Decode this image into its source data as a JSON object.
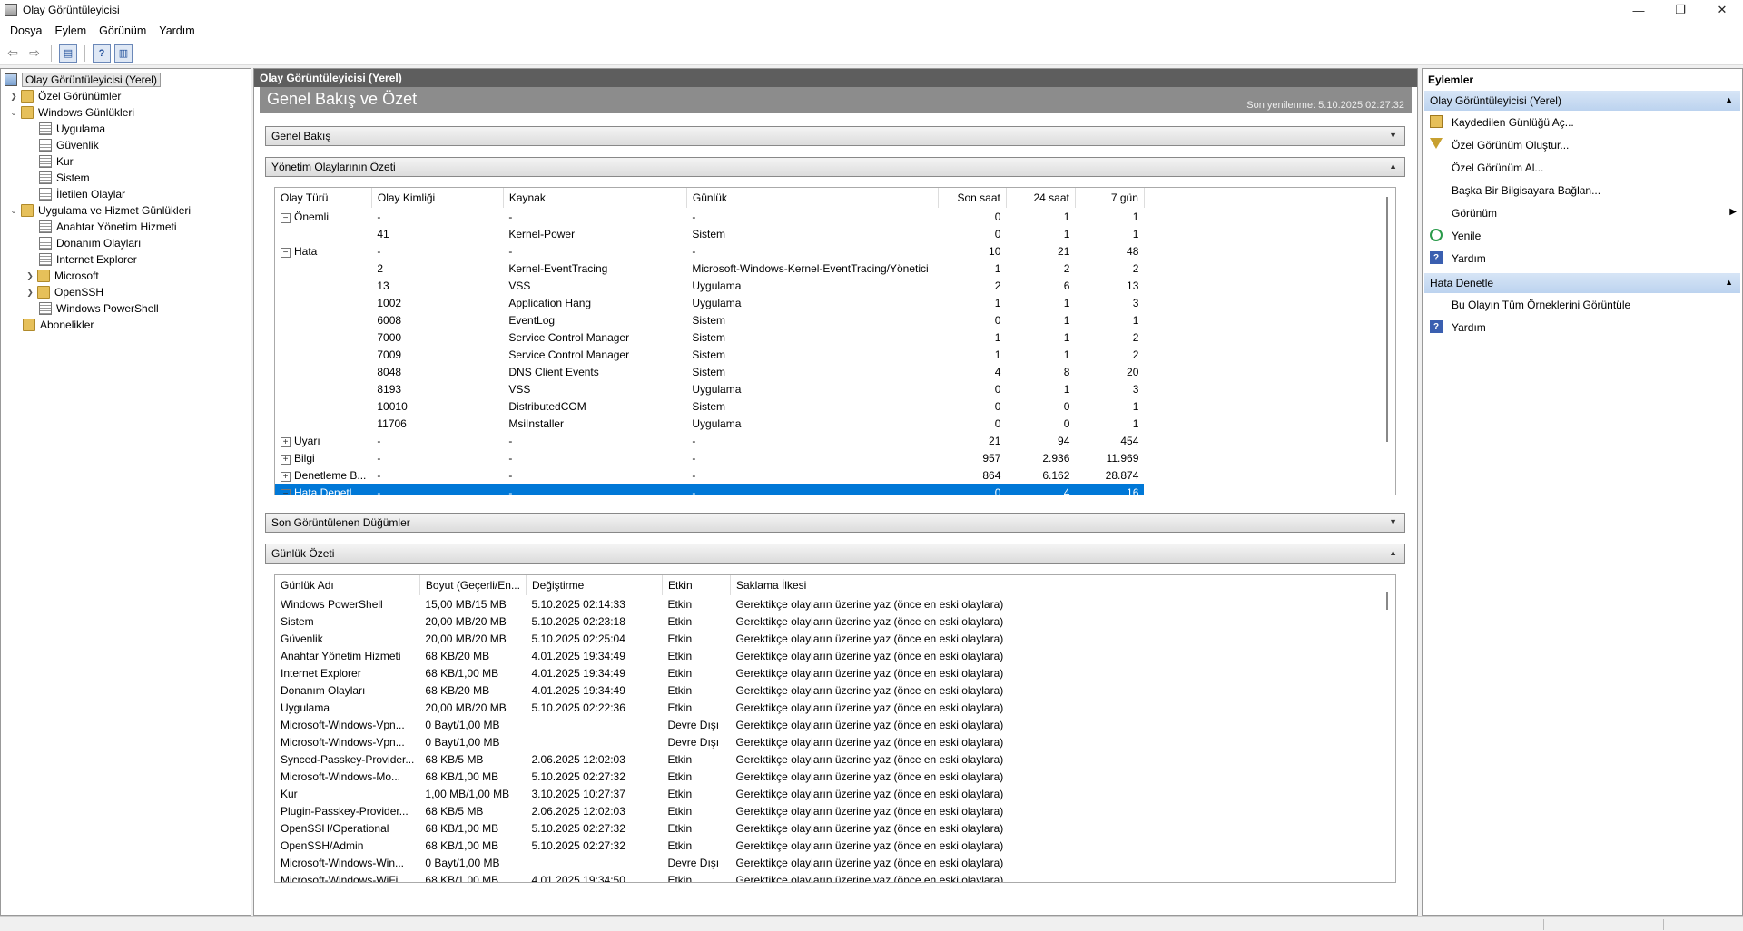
{
  "window": {
    "title": "Olay Görüntüleyicisi"
  },
  "menu": [
    "Dosya",
    "Eylem",
    "Görünüm",
    "Yardım"
  ],
  "tree": {
    "root": "Olay Görüntüleyicisi (Yerel)",
    "custom_views": "Özel Görünümler",
    "windows_logs": "Windows Günlükleri",
    "windows_log_items": [
      "Uygulama",
      "Güvenlik",
      "Kur",
      "Sistem",
      "İletilen Olaylar"
    ],
    "app_service_logs": "Uygulama ve Hizmet Günlükleri",
    "app_service_items": [
      "Anahtar Yönetim Hizmeti",
      "Donanım Olayları",
      "Internet Explorer",
      "Microsoft",
      "OpenSSH",
      "Windows PowerShell"
    ],
    "subscriptions": "Abonelikler"
  },
  "center": {
    "header": "Olay Görüntüleyicisi (Yerel)",
    "banner_title": "Genel Bakış ve Özet",
    "last_refreshed": "Son yenilenme: 5.10.2025 02:27:32",
    "sections": {
      "overview": "Genel Bakış",
      "admin_events": "Yönetim Olaylarının Özeti",
      "recent_nodes": "Son Görüntülenen Düğümler",
      "log_summary": "Günlük Özeti"
    },
    "admin_table": {
      "columns": [
        "Olay Türü",
        "Olay Kimliği",
        "Kaynak",
        "Günlük",
        "Son saat",
        "24 saat",
        "7 gün"
      ],
      "rows": [
        {
          "type": "Önemli",
          "expander": "−",
          "id": "-",
          "source": "-",
          "log": "-",
          "h1": "0",
          "h24": "1",
          "d7": "1"
        },
        {
          "type": "",
          "expander": "",
          "id": "41",
          "source": "Kernel-Power",
          "log": "Sistem",
          "h1": "0",
          "h24": "1",
          "d7": "1"
        },
        {
          "type": "Hata",
          "expander": "−",
          "id": "-",
          "source": "-",
          "log": "-",
          "h1": "10",
          "h24": "21",
          "d7": "48"
        },
        {
          "type": "",
          "expander": "",
          "id": "2",
          "source": "Kernel-EventTracing",
          "log": "Microsoft-Windows-Kernel-EventTracing/Yönetici",
          "h1": "1",
          "h24": "2",
          "d7": "2"
        },
        {
          "type": "",
          "expander": "",
          "id": "13",
          "source": "VSS",
          "log": "Uygulama",
          "h1": "2",
          "h24": "6",
          "d7": "13"
        },
        {
          "type": "",
          "expander": "",
          "id": "1002",
          "source": "Application Hang",
          "log": "Uygulama",
          "h1": "1",
          "h24": "1",
          "d7": "3"
        },
        {
          "type": "",
          "expander": "",
          "id": "6008",
          "source": "EventLog",
          "log": "Sistem",
          "h1": "0",
          "h24": "1",
          "d7": "1"
        },
        {
          "type": "",
          "expander": "",
          "id": "7000",
          "source": "Service Control Manager",
          "log": "Sistem",
          "h1": "1",
          "h24": "1",
          "d7": "2"
        },
        {
          "type": "",
          "expander": "",
          "id": "7009",
          "source": "Service Control Manager",
          "log": "Sistem",
          "h1": "1",
          "h24": "1",
          "d7": "2"
        },
        {
          "type": "",
          "expander": "",
          "id": "8048",
          "source": "DNS Client Events",
          "log": "Sistem",
          "h1": "4",
          "h24": "8",
          "d7": "20"
        },
        {
          "type": "",
          "expander": "",
          "id": "8193",
          "source": "VSS",
          "log": "Uygulama",
          "h1": "0",
          "h24": "1",
          "d7": "3"
        },
        {
          "type": "",
          "expander": "",
          "id": "10010",
          "source": "DistributedCOM",
          "log": "Sistem",
          "h1": "0",
          "h24": "0",
          "d7": "1"
        },
        {
          "type": "",
          "expander": "",
          "id": "11706",
          "source": "MsiInstaller",
          "log": "Uygulama",
          "h1": "0",
          "h24": "0",
          "d7": "1"
        },
        {
          "type": "Uyarı",
          "expander": "+",
          "id": "-",
          "source": "-",
          "log": "-",
          "h1": "21",
          "h24": "94",
          "d7": "454"
        },
        {
          "type": "Bilgi",
          "expander": "+",
          "id": "-",
          "source": "-",
          "log": "-",
          "h1": "957",
          "h24": "2.936",
          "d7": "11.969"
        },
        {
          "type": "Denetleme B...",
          "expander": "+",
          "id": "-",
          "source": "-",
          "log": "-",
          "h1": "864",
          "h24": "6.162",
          "d7": "28.874"
        },
        {
          "type": "Hata Denetl...",
          "expander": "−",
          "id": "-",
          "source": "-",
          "log": "-",
          "h1": "0",
          "h24": "4",
          "d7": "16",
          "selected": true
        }
      ]
    },
    "log_table": {
      "columns": [
        "Günlük Adı",
        "Boyut (Geçerli/En...",
        "Değiştirme",
        "Etkin",
        "Saklama İlkesi"
      ],
      "rows": [
        {
          "name": "Windows PowerShell",
          "size": "15,00 MB/15 MB",
          "modified": "5.10.2025 02:14:33",
          "enabled": "Etkin",
          "policy": "Gerektikçe olayların üzerine yaz (önce en eski olaylara)"
        },
        {
          "name": "Sistem",
          "size": "20,00 MB/20 MB",
          "modified": "5.10.2025 02:23:18",
          "enabled": "Etkin",
          "policy": "Gerektikçe olayların üzerine yaz (önce en eski olaylara)"
        },
        {
          "name": "Güvenlik",
          "size": "20,00 MB/20 MB",
          "modified": "5.10.2025 02:25:04",
          "enabled": "Etkin",
          "policy": "Gerektikçe olayların üzerine yaz (önce en eski olaylara)"
        },
        {
          "name": "Anahtar Yönetim Hizmeti",
          "size": "68 KB/20 MB",
          "modified": "4.01.2025 19:34:49",
          "enabled": "Etkin",
          "policy": "Gerektikçe olayların üzerine yaz (önce en eski olaylara)"
        },
        {
          "name": "Internet Explorer",
          "size": "68 KB/1,00 MB",
          "modified": "4.01.2025 19:34:49",
          "enabled": "Etkin",
          "policy": "Gerektikçe olayların üzerine yaz (önce en eski olaylara)"
        },
        {
          "name": "Donanım Olayları",
          "size": "68 KB/20 MB",
          "modified": "4.01.2025 19:34:49",
          "enabled": "Etkin",
          "policy": "Gerektikçe olayların üzerine yaz (önce en eski olaylara)"
        },
        {
          "name": "Uygulama",
          "size": "20,00 MB/20 MB",
          "modified": "5.10.2025 02:22:36",
          "enabled": "Etkin",
          "policy": "Gerektikçe olayların üzerine yaz (önce en eski olaylara)"
        },
        {
          "name": "Microsoft-Windows-Vpn...",
          "size": "0 Bayt/1,00 MB",
          "modified": "",
          "enabled": "Devre Dışı",
          "policy": "Gerektikçe olayların üzerine yaz (önce en eski olaylara)"
        },
        {
          "name": "Microsoft-Windows-Vpn...",
          "size": "0 Bayt/1,00 MB",
          "modified": "",
          "enabled": "Devre Dışı",
          "policy": "Gerektikçe olayların üzerine yaz (önce en eski olaylara)"
        },
        {
          "name": "Synced-Passkey-Provider...",
          "size": "68 KB/5 MB",
          "modified": "2.06.2025 12:02:03",
          "enabled": "Etkin",
          "policy": "Gerektikçe olayların üzerine yaz (önce en eski olaylara)"
        },
        {
          "name": "Microsoft-Windows-Mo...",
          "size": "68 KB/1,00 MB",
          "modified": "5.10.2025 02:27:32",
          "enabled": "Etkin",
          "policy": "Gerektikçe olayların üzerine yaz (önce en eski olaylara)"
        },
        {
          "name": "Kur",
          "size": "1,00 MB/1,00 MB",
          "modified": "3.10.2025 10:27:37",
          "enabled": "Etkin",
          "policy": "Gerektikçe olayların üzerine yaz (önce en eski olaylara)"
        },
        {
          "name": "Plugin-Passkey-Provider...",
          "size": "68 KB/5 MB",
          "modified": "2.06.2025 12:02:03",
          "enabled": "Etkin",
          "policy": "Gerektikçe olayların üzerine yaz (önce en eski olaylara)"
        },
        {
          "name": "OpenSSH/Operational",
          "size": "68 KB/1,00 MB",
          "modified": "5.10.2025 02:27:32",
          "enabled": "Etkin",
          "policy": "Gerektikçe olayların üzerine yaz (önce en eski olaylara)"
        },
        {
          "name": "OpenSSH/Admin",
          "size": "68 KB/1,00 MB",
          "modified": "5.10.2025 02:27:32",
          "enabled": "Etkin",
          "policy": "Gerektikçe olayların üzerine yaz (önce en eski olaylara)"
        },
        {
          "name": "Microsoft-Windows-Win...",
          "size": "0 Bayt/1,00 MB",
          "modified": "",
          "enabled": "Devre Dışı",
          "policy": "Gerektikçe olayların üzerine yaz (önce en eski olaylara)"
        },
        {
          "name": "Microsoft-Windows-WiFi...",
          "size": "68 KB/1,00 MB",
          "modified": "4.01.2025 19:34:50",
          "enabled": "Etkin",
          "policy": "Gerektikçe olayların üzerine yaz (önce en eski olaylara)"
        }
      ]
    }
  },
  "actions": {
    "title": "Eylemler",
    "group1": {
      "header": "Olay Görüntüleyicisi (Yerel)",
      "items": [
        "Kaydedilen Günlüğü Aç...",
        "Özel Görünüm Oluştur...",
        "Özel Görünüm Al...",
        "Başka Bir Bilgisayara Bağlan...",
        "Görünüm",
        "Yenile",
        "Yardım"
      ]
    },
    "group2": {
      "header": "Hata Denetle",
      "items": [
        "Bu Olayın Tüm Örneklerini Görüntüle",
        "Yardım"
      ]
    }
  },
  "colors": {
    "selection": "#0078d7",
    "section_header": "#5e5e5e",
    "banner": "#8c8c8c",
    "action_header": "#c8daf1"
  }
}
